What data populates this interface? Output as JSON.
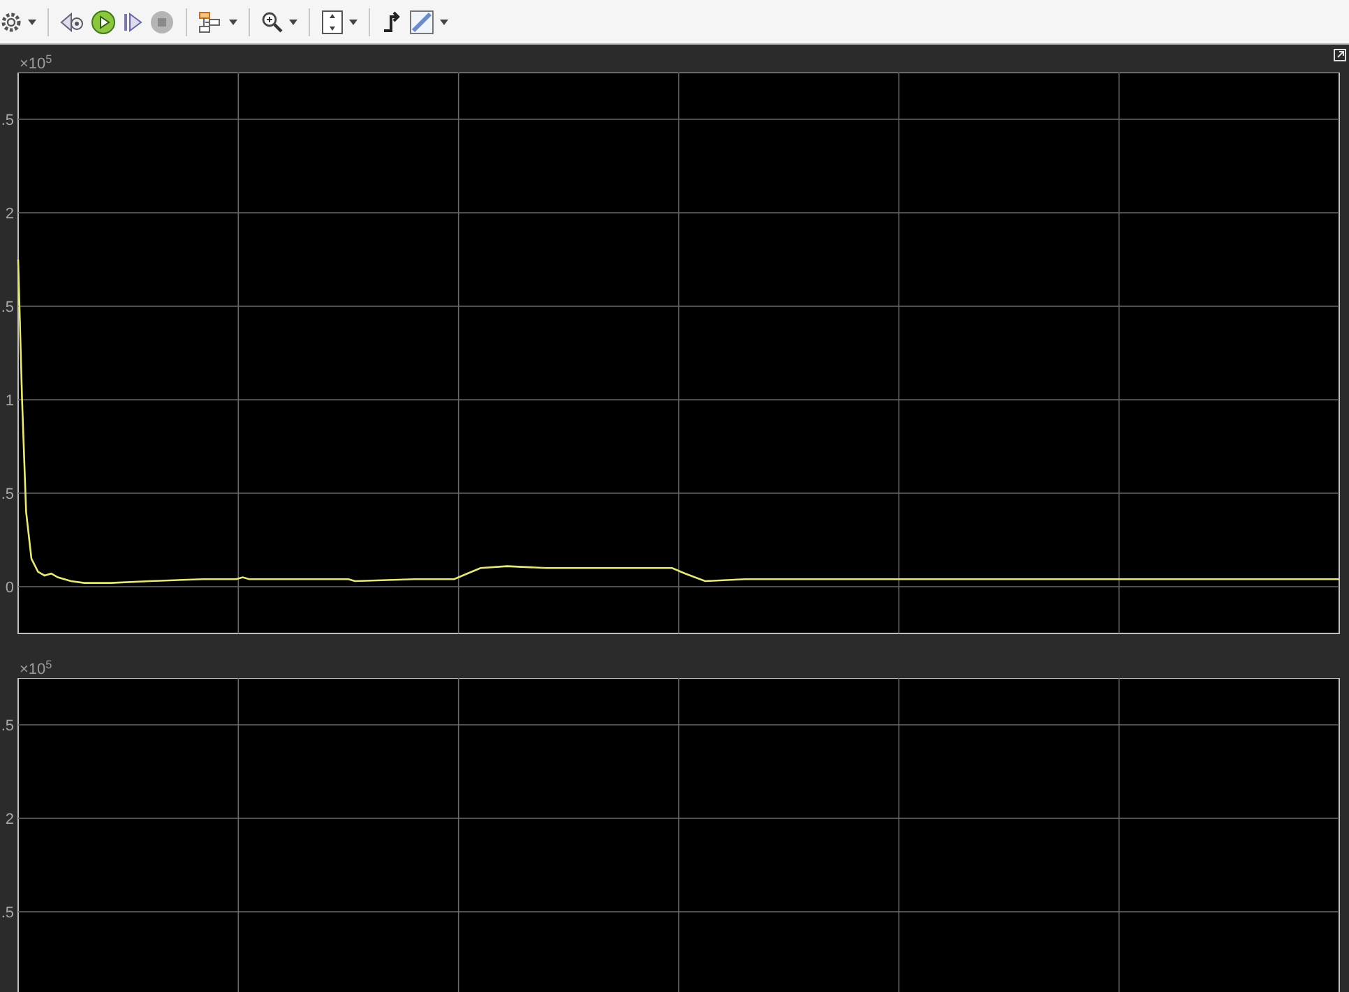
{
  "toolbar": {
    "stop_disabled": true
  },
  "plots": [
    {
      "multiplier": "×10$^{5}$",
      "trace": true,
      "ytick_labels": [
        ".5",
        "2",
        ".5",
        "1",
        ".5",
        "0"
      ]
    },
    {
      "multiplier": "×10$^{5}$",
      "trace": false,
      "ytick_labels": [
        ".5",
        "2",
        ".5"
      ]
    }
  ]
}
